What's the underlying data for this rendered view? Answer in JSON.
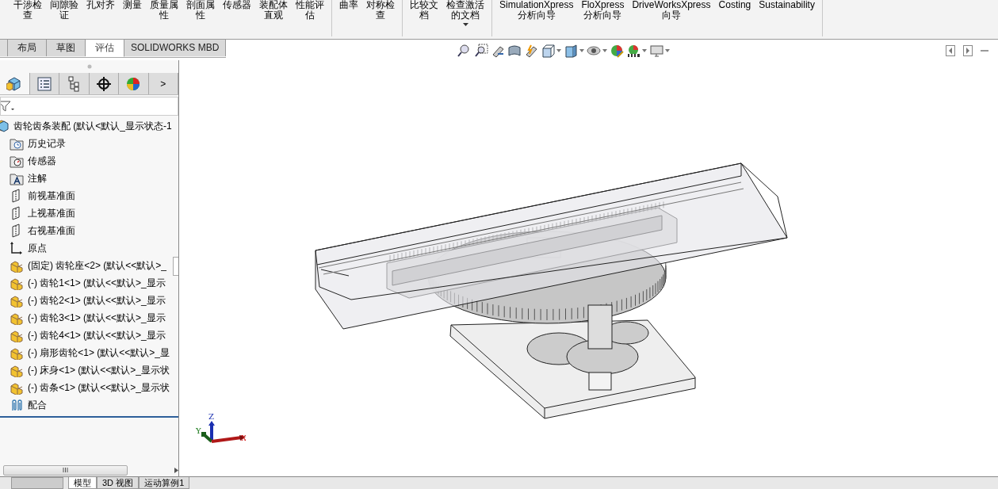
{
  "ribbon": {
    "groups": [
      {
        "items": [
          {
            "lines": [
              "干涉检",
              "查"
            ]
          },
          {
            "lines": [
              "间隙验",
              "证"
            ]
          },
          {
            "lines": [
              "孔对齐"
            ]
          },
          {
            "lines": [
              "测量"
            ]
          },
          {
            "lines": [
              "质量属",
              "性"
            ]
          },
          {
            "lines": [
              "剖面属",
              "性"
            ]
          },
          {
            "lines": [
              "传感器"
            ]
          },
          {
            "lines": [
              "装配体",
              "直观"
            ]
          },
          {
            "lines": [
              "性能评",
              "估"
            ]
          }
        ]
      },
      {
        "items": [
          {
            "lines": [
              "曲率"
            ]
          },
          {
            "lines": [
              "对称检",
              "查"
            ]
          }
        ]
      },
      {
        "items": [
          {
            "lines": [
              "比较文",
              "档"
            ]
          },
          {
            "lines": [
              "检查激活",
              "的文档"
            ],
            "dropdown": true
          }
        ]
      },
      {
        "items": [
          {
            "lines": [
              "SimulationXpress",
              "分析向导"
            ]
          },
          {
            "lines": [
              "FloXpress",
              "分析向导"
            ]
          },
          {
            "lines": [
              "DriveWorksXpress",
              "向导"
            ]
          },
          {
            "lines": [
              "Costing"
            ]
          },
          {
            "lines": [
              "Sustainability"
            ]
          }
        ]
      }
    ]
  },
  "command_tabs": [
    {
      "label": "布局",
      "selected": false
    },
    {
      "label": "草图",
      "selected": false
    },
    {
      "label": "评估",
      "selected": true
    },
    {
      "label": "SOLIDWORKS MBD",
      "selected": false
    }
  ],
  "panel_tabs": [
    {
      "kind": "feature",
      "selected": true
    },
    {
      "kind": "property",
      "selected": false
    },
    {
      "kind": "config",
      "selected": false
    },
    {
      "kind": "dimxpert",
      "selected": false
    },
    {
      "kind": "display",
      "selected": false
    }
  ],
  "panel_more": ">",
  "tree": {
    "label": "齿轮齿条装配  (默认<默认_显示状态-1",
    "kind": "assembly",
    "children": [
      {
        "label": "历史记录",
        "kind": "history"
      },
      {
        "label": "传感器",
        "kind": "sensor"
      },
      {
        "label": "注解",
        "kind": "annotation"
      },
      {
        "label": "前视基准面",
        "kind": "plane"
      },
      {
        "label": "上视基准面",
        "kind": "plane"
      },
      {
        "label": "右视基准面",
        "kind": "plane"
      },
      {
        "label": "原点",
        "kind": "origin"
      },
      {
        "label": "(固定) 齿轮座<2> (默认<<默认>_",
        "kind": "part"
      },
      {
        "label": "(-) 齿轮1<1> (默认<<默认>_显示",
        "kind": "part"
      },
      {
        "label": "(-) 齿轮2<1> (默认<<默认>_显示",
        "kind": "part"
      },
      {
        "label": "(-) 齿轮3<1> (默认<<默认>_显示",
        "kind": "part"
      },
      {
        "label": "(-) 齿轮4<1> (默认<<默认>_显示",
        "kind": "part"
      },
      {
        "label": "(-) 扇形齿轮<1> (默认<<默认>_显",
        "kind": "part"
      },
      {
        "label": "(-) 床身<1> (默认<<默认>_显示状",
        "kind": "part"
      },
      {
        "label": "(-) 齿条<1> (默认<<默认>_显示状",
        "kind": "part"
      },
      {
        "label": "配合",
        "kind": "mates"
      }
    ]
  },
  "triad": {
    "z": "Z",
    "y": "Y",
    "x": "X"
  },
  "bottom_tabs": [
    {
      "label": "模型",
      "selected": true
    },
    {
      "label": "3D 视图",
      "selected": false
    },
    {
      "label": "运动算例1",
      "selected": false
    }
  ]
}
